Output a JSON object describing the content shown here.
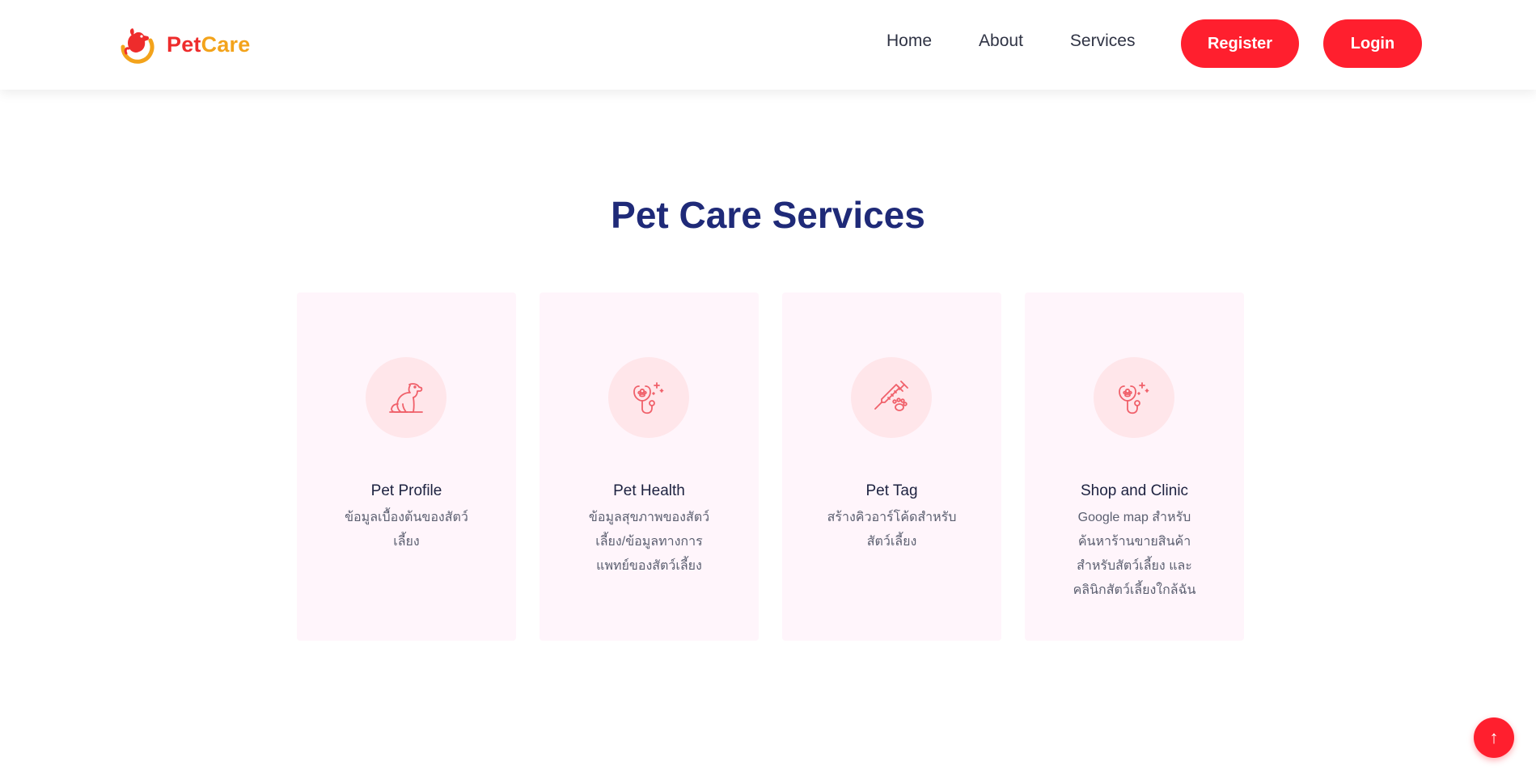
{
  "brand": {
    "name_part1": "Pet",
    "name_part2": "Care",
    "logo_icon": "dog-logo-icon"
  },
  "nav": {
    "links": [
      "Home",
      "About",
      "Services"
    ],
    "register_label": "Register",
    "login_label": "Login"
  },
  "services": {
    "title": "Pet Care Services",
    "cards": [
      {
        "icon": "dog-icon",
        "title": "Pet Profile",
        "description": "ข้อมูลเบื้องต้นของสัตว์เลี้ยง"
      },
      {
        "icon": "stethoscope-icon",
        "title": "Pet Health",
        "description": "ข้อมูลสุขภาพของสัตว์เลี้ยง/ข้อมูลทางการแพทย์ของสัตว์เลี้ยง"
      },
      {
        "icon": "syringe-paw-icon",
        "title": "Pet Tag",
        "description": "สร้างคิวอาร์โค้ดสำหรับสัตว์เลี้ยง"
      },
      {
        "icon": "stethoscope-icon",
        "title": "Shop and Clinic",
        "description": "Google map สำหรับค้นหาร้านขายสินค้าสำหรับสัตว์เลี้ยง และคลินิกสัตว์เลี้ยงใกล้ฉัน"
      }
    ]
  },
  "scroll_top": {
    "icon": "arrow-up-icon",
    "glyph": "↑"
  },
  "colors": {
    "accent": "#ff1f2e",
    "title": "#1f2a78",
    "card_bg": "#fff5fb",
    "icon_bg": "#ffe6ea",
    "brand_red": "#ee2c2c",
    "brand_orange": "#f3a31b"
  }
}
